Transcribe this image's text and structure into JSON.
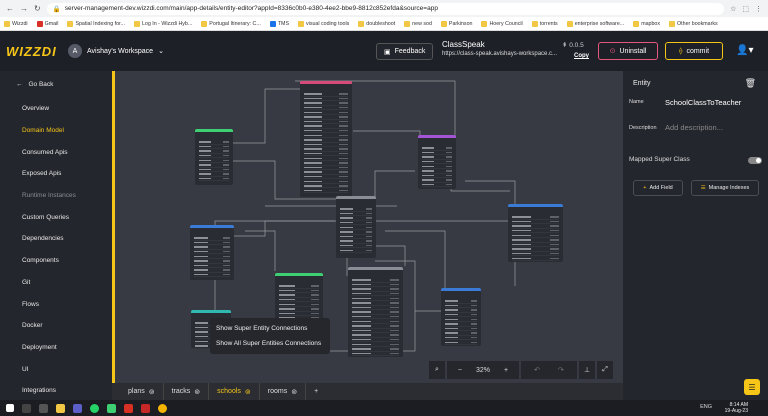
{
  "browser": {
    "url": "server-management-dev.wizzdi.com/main/app-details/entity-editor?appId=8336c0b0-e380-4ee2-bbe9-8812c852efda&source=app",
    "bookmarks": [
      "Wizzdi",
      "Gmail",
      "Spatial Indexing for...",
      "Log In - Wizzdi Hyb...",
      "Portugal Itinerary: C...",
      "TMS",
      "visual coding tools",
      "doubleshoot",
      "new sod",
      "Parkinson",
      "Hoery Council",
      "torrents",
      "enterprise software...",
      "mapbox",
      "Other bookmarks"
    ]
  },
  "header": {
    "logo": "WIZZDI",
    "workspace_initial": "A",
    "workspace_name": "Avishay's Workspace",
    "feedback_label": "Feedback",
    "app_name": "ClassSpeak",
    "app_url": "https://class-speak.avishays-workspace.c...",
    "copy_label": "Copy",
    "version": "0.0.5",
    "uninstall_label": "Uninstall",
    "commit_label": "commit"
  },
  "sidebar": {
    "back_label": "Go Back",
    "items": [
      {
        "label": "Overview",
        "state": "normal"
      },
      {
        "label": "Domain Model",
        "state": "active"
      },
      {
        "label": "Consumed Apis",
        "state": "normal"
      },
      {
        "label": "Exposed Apis",
        "state": "normal"
      },
      {
        "label": "Runtime Instances",
        "state": "muted"
      },
      {
        "label": "Custom Queries",
        "state": "normal"
      },
      {
        "label": "Dependencies",
        "state": "normal"
      },
      {
        "label": "Components",
        "state": "normal"
      },
      {
        "label": "Git",
        "state": "normal"
      },
      {
        "label": "Flows",
        "state": "normal"
      },
      {
        "label": "Docker",
        "state": "normal"
      },
      {
        "label": "Deployment",
        "state": "normal"
      },
      {
        "label": "UI",
        "state": "normal"
      },
      {
        "label": "Integrations",
        "state": "normal"
      }
    ]
  },
  "context_menu": {
    "items": [
      "Show Super Entity Connections",
      "Show All Super Entities Connections"
    ]
  },
  "zoom": {
    "level": "32%"
  },
  "tabs": [
    {
      "label": "plans",
      "active": false
    },
    {
      "label": "tracks",
      "active": false
    },
    {
      "label": "schools",
      "active": true
    },
    {
      "label": "rooms",
      "active": false
    }
  ],
  "entity_panel": {
    "title": "Entity",
    "name_label": "Name",
    "name_value": "SchoolClassToTeacher",
    "description_label": "Description",
    "description_placeholder": "Add description...",
    "mapped_super_label": "Mapped Super Class",
    "mapped_super_on": false,
    "add_field_label": "Add Field",
    "manage_indexes_label": "Manage Indexes"
  },
  "taskbar": {
    "time": "8:14 AM",
    "date": "19-Aug-23",
    "lang": "ENG"
  },
  "colors": {
    "accent": "#f5c518",
    "uninstall": "#e6577d",
    "entity_pink": "#d64b7a",
    "entity_green": "#3ecf72",
    "entity_purple": "#a455d6",
    "entity_blue": "#3a7bd5",
    "entity_teal": "#2fb9b0",
    "entity_grey": "#8a8d96"
  }
}
